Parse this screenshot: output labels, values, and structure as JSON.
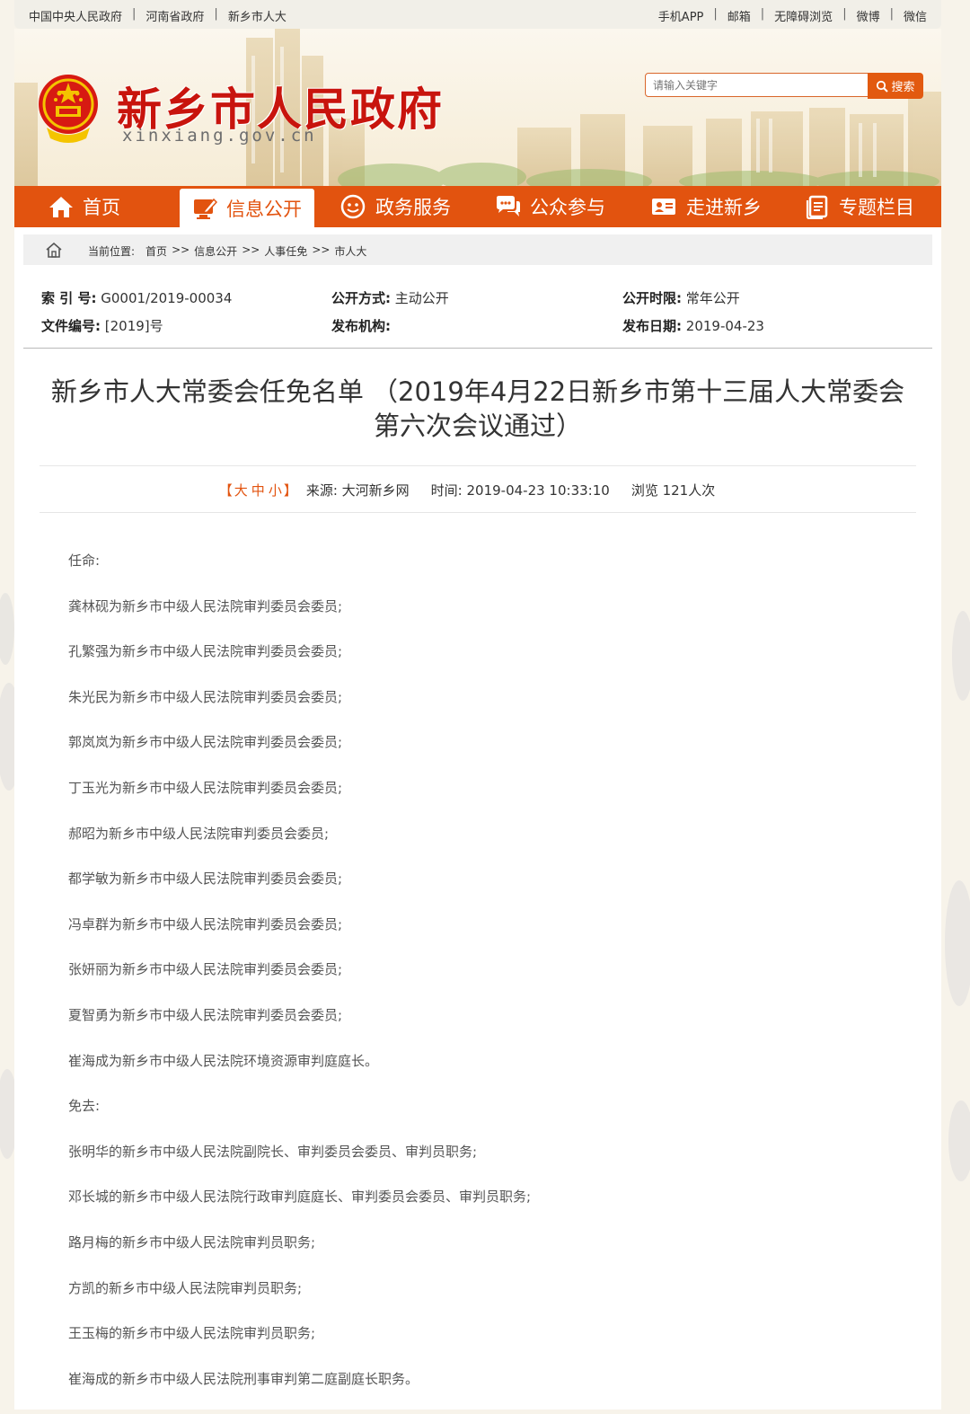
{
  "topbar": {
    "left_links": [
      "中国中央人民政府",
      "河南省政府",
      "新乡市人大"
    ],
    "right_links": [
      "手机APP",
      "邮箱",
      "无障碍浏览",
      "微博",
      "微信"
    ],
    "separator": "|"
  },
  "header": {
    "site_title": "新乡市人民政府",
    "site_domain": "xinxiang.gov.cn",
    "search_placeholder": "请输入关键字",
    "search_button": "搜索"
  },
  "nav": {
    "items": [
      {
        "label": "首页",
        "icon": "home-icon"
      },
      {
        "label": "信息公开",
        "icon": "monitor-edit-icon",
        "active": true
      },
      {
        "label": "政务服务",
        "icon": "service-icon"
      },
      {
        "label": "公众参与",
        "icon": "chat-bubbles-icon"
      },
      {
        "label": "走进新乡",
        "icon": "id-card-icon"
      },
      {
        "label": "专题栏目",
        "icon": "document-icon"
      }
    ]
  },
  "breadcrumb": {
    "label": "当前位置:",
    "items": [
      "首页",
      ">>",
      "信息公开",
      ">>",
      "人事任免",
      ">>",
      "市人大"
    ]
  },
  "meta": {
    "index_label": "索 引 号:",
    "index_value": "G0001/2019-00034",
    "method_label": "公开方式:",
    "method_value": "主动公开",
    "period_label": "公开时限:",
    "period_value": "常年公开",
    "docno_label": "文件编号:",
    "docno_value": "[2019]号",
    "org_label": "发布机构:",
    "org_value": "",
    "date_label": "发布日期:",
    "date_value": "2019-04-23"
  },
  "article": {
    "title_line1": "新乡市人大常委会任免名单 （2019年4月22日新乡市第十三届人大常委会",
    "title_line2": "第六次会议通过）",
    "font_size_open": "【",
    "font_size_big": "大",
    "font_size_mid": "中",
    "font_size_small": "小",
    "font_size_close": "】",
    "source": "来源:  大河新乡网",
    "time": "时间:  2019-04-23 10:33:10",
    "views": "浏览 121人次",
    "paragraphs": [
      "任命:",
      "龚林砚为新乡市中级人民法院审判委员会委员;",
      "孔繁强为新乡市中级人民法院审判委员会委员;",
      "朱光民为新乡市中级人民法院审判委员会委员;",
      "郭岚岚为新乡市中级人民法院审判委员会委员;",
      "丁玉光为新乡市中级人民法院审判委员会委员;",
      "郝昭为新乡市中级人民法院审判委员会委员;",
      "都学敏为新乡市中级人民法院审判委员会委员;",
      "冯卓群为新乡市中级人民法院审判委员会委员;",
      "张妍丽为新乡市中级人民法院审判委员会委员;",
      "夏智勇为新乡市中级人民法院审判委员会委员;",
      "崔海成为新乡市中级人民法院环境资源审判庭庭长。",
      "免去:",
      "张明华的新乡市中级人民法院副院长、审判委员会委员、审判员职务;",
      "邓长城的新乡市中级人民法院行政审判庭庭长、审判委员会委员、审判员职务;",
      "路月梅的新乡市中级人民法院审判员职务;",
      "方凯的新乡市中级人民法院审判员职务;",
      "王玉梅的新乡市中级人民法院审判员职务;",
      "崔海成的新乡市中级人民法院刑事审判第二庭副庭长职务。"
    ]
  },
  "colors": {
    "brand_orange": "#e2530f",
    "title_red": "#c8140d"
  }
}
